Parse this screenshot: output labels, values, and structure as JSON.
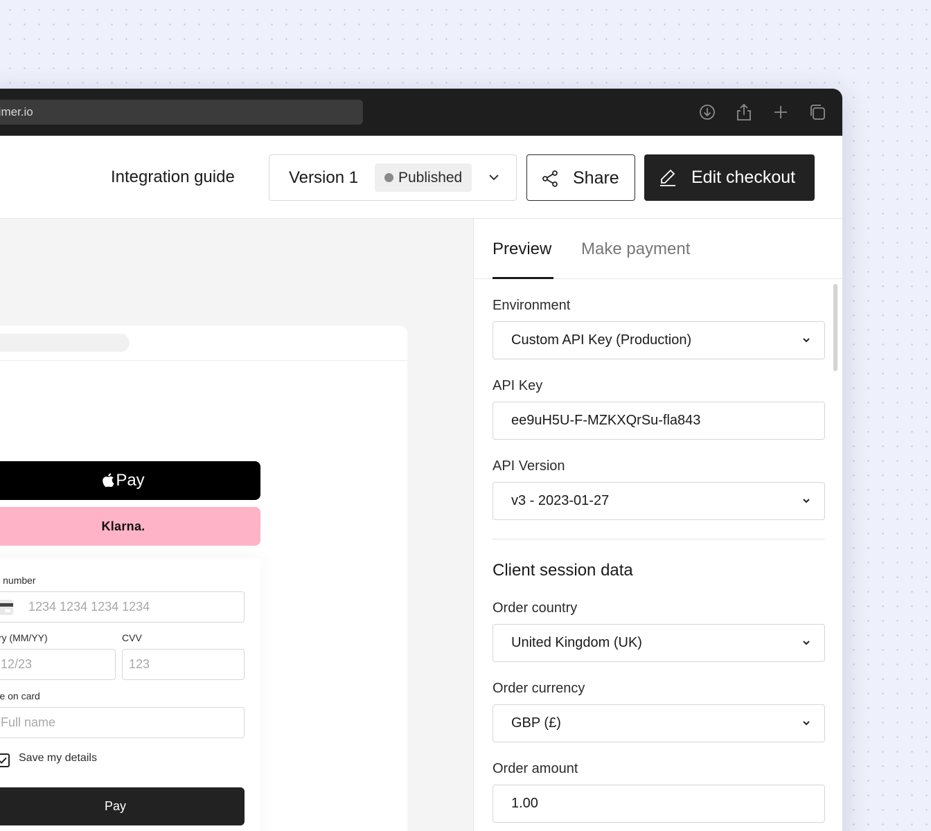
{
  "browser": {
    "url": "rimer.io",
    "icons": [
      "download-icon",
      "share-icon",
      "plus-icon",
      "tabs-icon"
    ]
  },
  "toolbar": {
    "guide_label": "Integration guide",
    "version_label": "Version 1",
    "status_label": "Published",
    "share_label": "Share",
    "edit_label": "Edit checkout"
  },
  "checkout": {
    "apple_pay_label": "Pay",
    "klarna_label": "Klarna.",
    "card_number_label": "ard number",
    "card_number_placeholder": "1234 1234 1234 1234",
    "expiry_label": "xpiry (MM/YY)",
    "expiry_placeholder": "12/23",
    "cvv_label": "CVV",
    "cvv_placeholder": "123",
    "name_label": "ame on card",
    "name_placeholder": "Full name",
    "save_label": "Save my details",
    "save_checked": true,
    "pay_label": "Pay"
  },
  "panel": {
    "tabs": [
      {
        "label": "Preview",
        "active": true
      },
      {
        "label": "Make payment",
        "active": false
      }
    ],
    "environment_label": "Environment",
    "environment_value": "Custom API Key (Production)",
    "api_key_label": "API Key",
    "api_key_value": "ee9uH5U-F-MZKXQrSu-fla843",
    "api_version_label": "API Version",
    "api_version_value": "v3 - 2023-01-27",
    "section_title": "Client session data",
    "order_country_label": "Order country",
    "order_country_value": "United Kingdom (UK)",
    "order_currency_label": "Order currency",
    "order_currency_value": "GBP (£)",
    "order_amount_label": "Order amount",
    "order_amount_value": "1.00"
  },
  "colors": {
    "background": "#eef0fb",
    "titlebar": "#1e1e1e",
    "primary_button": "#222222",
    "klarna_pink": "#ffb3c7",
    "status_dot": "#8a8a8a"
  }
}
